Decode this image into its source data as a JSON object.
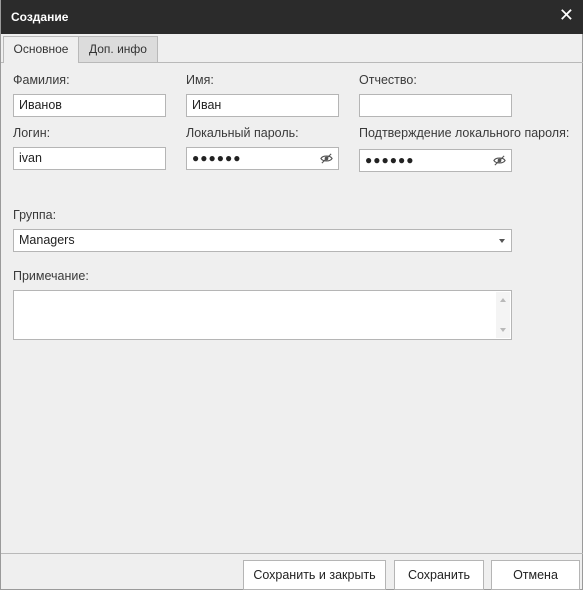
{
  "window": {
    "title": "Создание",
    "close_glyph": "✕"
  },
  "tabs": [
    {
      "label": "Основное",
      "active": true
    },
    {
      "label": "Доп. инфо",
      "active": false
    }
  ],
  "form": {
    "last_name": {
      "label": "Фамилия:",
      "value": "Иванов"
    },
    "first_name": {
      "label": "Имя:",
      "value": "Иван"
    },
    "middle_name": {
      "label": "Отчество:",
      "value": ""
    },
    "login": {
      "label": "Логин:",
      "value": "ivan"
    },
    "local_password": {
      "label": "Локальный пароль:",
      "value": "●●●●●●"
    },
    "confirm_password": {
      "label": "Подтверждение локального пароля:",
      "value": "●●●●●●"
    },
    "group": {
      "label": "Группа:",
      "value": "Managers"
    },
    "note": {
      "label": "Примечание:",
      "value": ""
    }
  },
  "buttons": {
    "save_close": "Сохранить и закрыть",
    "save": "Сохранить",
    "cancel": "Отмена"
  },
  "icons": [
    "close-icon",
    "eye-icon",
    "chevron-down-icon",
    "scroll-up-icon",
    "scroll-down-icon"
  ]
}
